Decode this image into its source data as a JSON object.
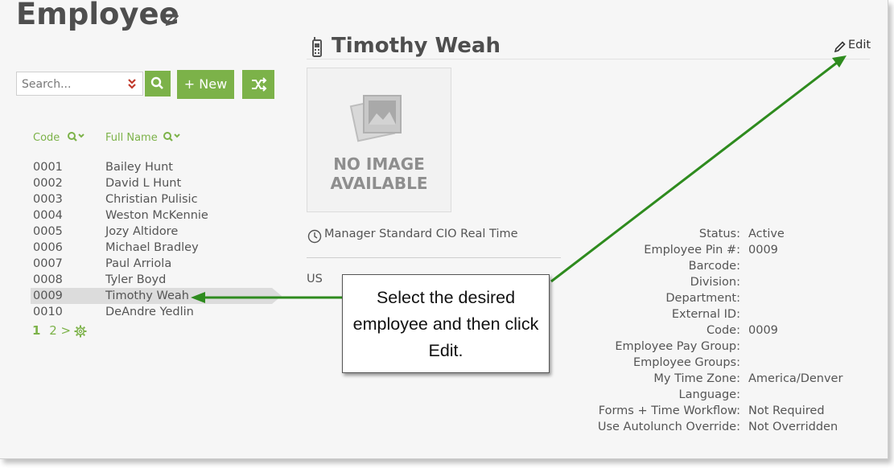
{
  "page": {
    "title": "Employee"
  },
  "toolbar": {
    "search_placeholder": "Search...",
    "new_label": "+ New"
  },
  "list": {
    "columns": {
      "code": "Code",
      "full_name": "Full Name"
    },
    "rows": [
      {
        "code": "0001",
        "name": "Bailey Hunt"
      },
      {
        "code": "0002",
        "name": "David L Hunt"
      },
      {
        "code": "0003",
        "name": "Christian Pulisic"
      },
      {
        "code": "0004",
        "name": "Weston McKennie"
      },
      {
        "code": "0005",
        "name": "Jozy Altidore"
      },
      {
        "code": "0006",
        "name": "Michael Bradley"
      },
      {
        "code": "0007",
        "name": "Paul Arriola"
      },
      {
        "code": "0008",
        "name": "Tyler Boyd"
      },
      {
        "code": "0009",
        "name": "Timothy Weah"
      },
      {
        "code": "0010",
        "name": "DeAndre Yedlin"
      }
    ],
    "selected_index": 8,
    "pager": {
      "current": "1",
      "next": "2 >"
    }
  },
  "detail": {
    "name": "Timothy Weah",
    "edit_label": "Edit",
    "photo_text": "NO IMAGE\nAVAILABLE",
    "schedule": "Manager Standard CIO Real Time",
    "country": "US",
    "fields": [
      {
        "label": "Status:",
        "value": "Active"
      },
      {
        "label": "Employee Pin #:",
        "value": "0009"
      },
      {
        "label": "Barcode:",
        "value": ""
      },
      {
        "label": "Division:",
        "value": ""
      },
      {
        "label": "Department:",
        "value": ""
      },
      {
        "label": "External ID:",
        "value": ""
      },
      {
        "label": "Code:",
        "value": "0009"
      },
      {
        "label": "Employee Pay Group:",
        "value": ""
      },
      {
        "label": "Employee Groups:",
        "value": ""
      },
      {
        "label": "My Time Zone:",
        "value": "America/Denver"
      },
      {
        "label": "Language:",
        "value": ""
      },
      {
        "label": "Forms + Time Workflow:",
        "value": "Not Required"
      },
      {
        "label": "Use Autolunch Override:",
        "value": "Not Overridden"
      }
    ]
  },
  "annotation": {
    "callout_text": "Select the desired employee and then click Edit."
  },
  "colors": {
    "accent": "#7cb249",
    "arrow": "#2e8b1e"
  }
}
